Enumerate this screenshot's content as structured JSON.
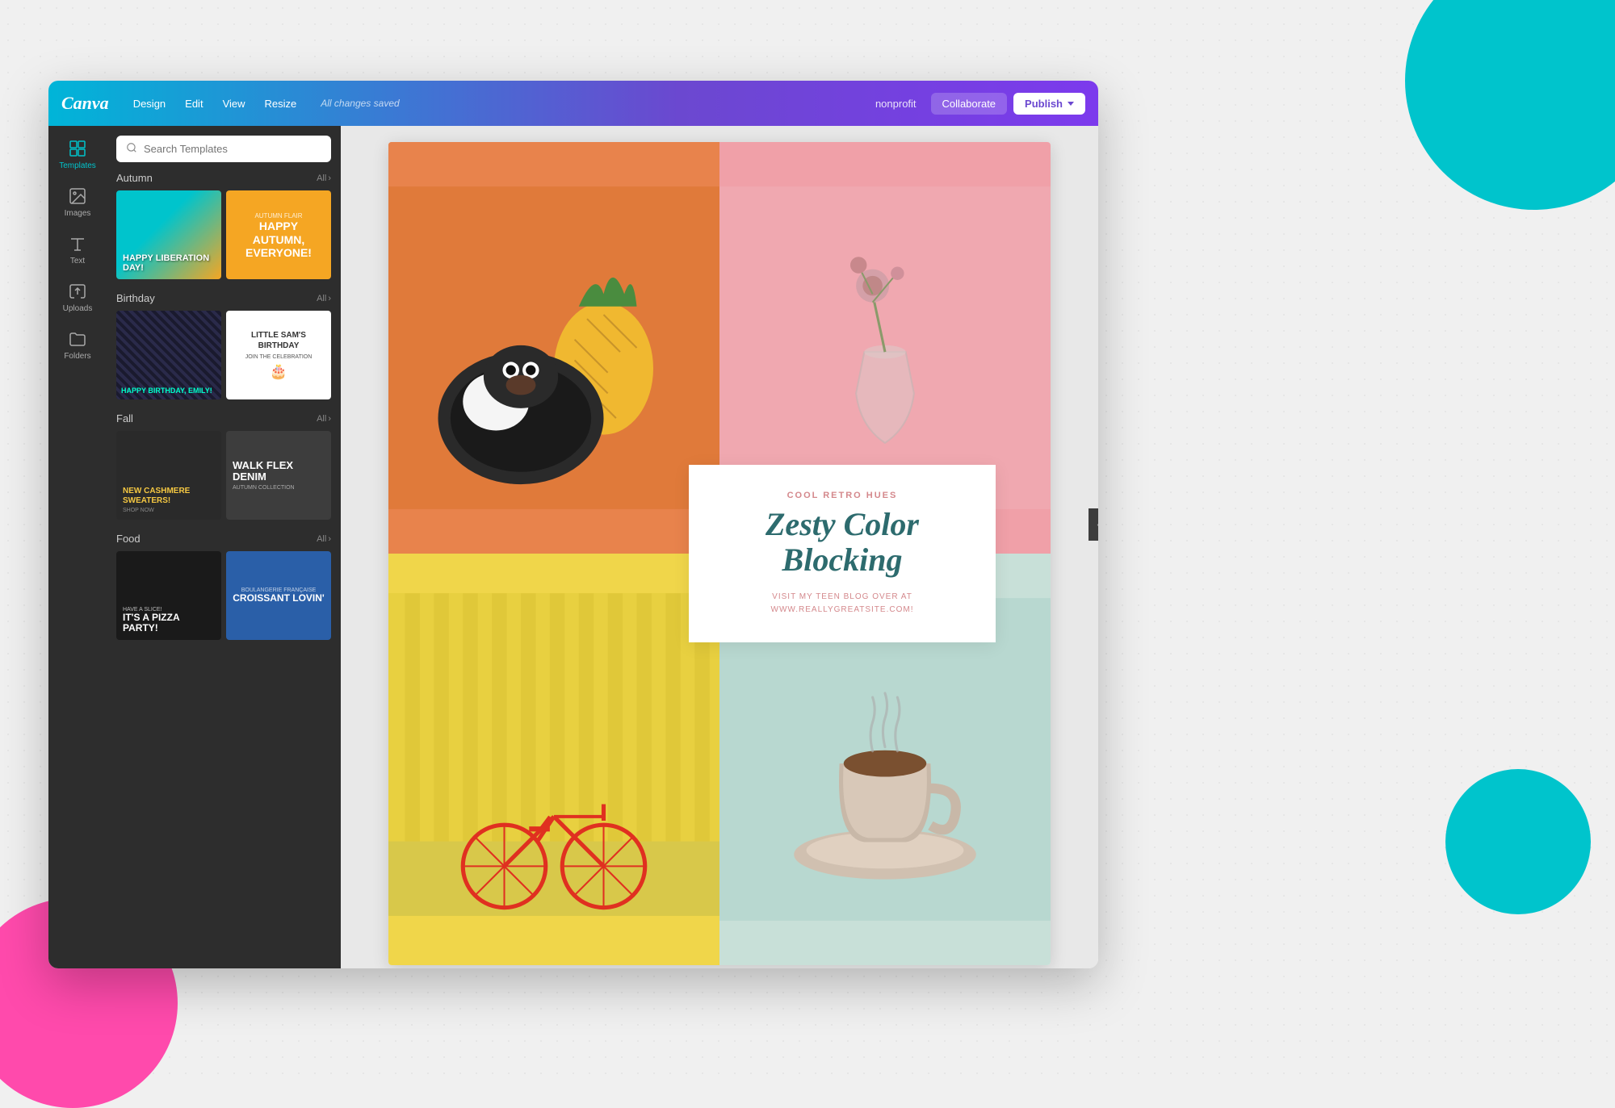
{
  "app": {
    "logo": "Canva",
    "menu": [
      "Design",
      "Edit",
      "View",
      "Resize"
    ],
    "status": "All changes saved",
    "toolbar_right": {
      "nonprofit": "nonprofit",
      "collaborate": "Collaborate",
      "publish": "Publish"
    }
  },
  "sidebar": {
    "items": [
      {
        "label": "Templates",
        "icon": "templates-icon"
      },
      {
        "label": "Images",
        "icon": "images-icon"
      },
      {
        "label": "Text",
        "icon": "text-icon"
      },
      {
        "label": "Uploads",
        "icon": "uploads-icon"
      },
      {
        "label": "Folders",
        "icon": "folders-icon"
      }
    ]
  },
  "templates_panel": {
    "search_placeholder": "Search Templates",
    "categories": [
      {
        "name": "Autumn",
        "all_label": "All",
        "templates": [
          {
            "label": "HAPPY LIBERATION DAY!"
          },
          {
            "label": "HAPPY AUTUMN, EVERYONE!",
            "sub": "AUTUMN FLAIR"
          }
        ]
      },
      {
        "name": "Birthday",
        "all_label": "All",
        "templates": [
          {
            "label": "HAPPY BIRTHDAY, EMILY!"
          },
          {
            "label": "LITTLE SAM'S BIRTHDAY",
            "sub": "JOIN THE CELEBRATION"
          }
        ]
      },
      {
        "name": "Fall",
        "all_label": "All",
        "templates": [
          {
            "label": "NEW CASHMERE SWEATERS!",
            "sub": "SHOP NOW"
          },
          {
            "label": "WALK FLEX DENIM",
            "sub": "AUTUMN COLLECTION"
          }
        ]
      },
      {
        "name": "Food",
        "all_label": "All",
        "templates": [
          {
            "label": "IT'S A PIZZA PARTY!",
            "sub": "HAVE A SLICE!"
          },
          {
            "label": "CROISSANT LOVIN'",
            "sub": "BOULANGERIE FRANÇAISE"
          }
        ]
      }
    ]
  },
  "canvas": {
    "overlay": {
      "label": "COOL RETRO HUES",
      "title": "Zesty Color Blocking",
      "body": "VISIT MY TEEN BLOG OVER AT\nWWW.REALLYGREATSITE.COM!"
    },
    "cells": {
      "tl_emoji": "🐹🍍",
      "tr_emoji": "🌸",
      "bl_emoji": "🚲",
      "br_emoji": "☕"
    }
  },
  "icons": {
    "search": "🔍",
    "templates": "⊞",
    "images": "🖼",
    "text": "T",
    "uploads": "⬆",
    "folders": "📁",
    "chevron_right": "›",
    "chevron_down": "▾"
  }
}
